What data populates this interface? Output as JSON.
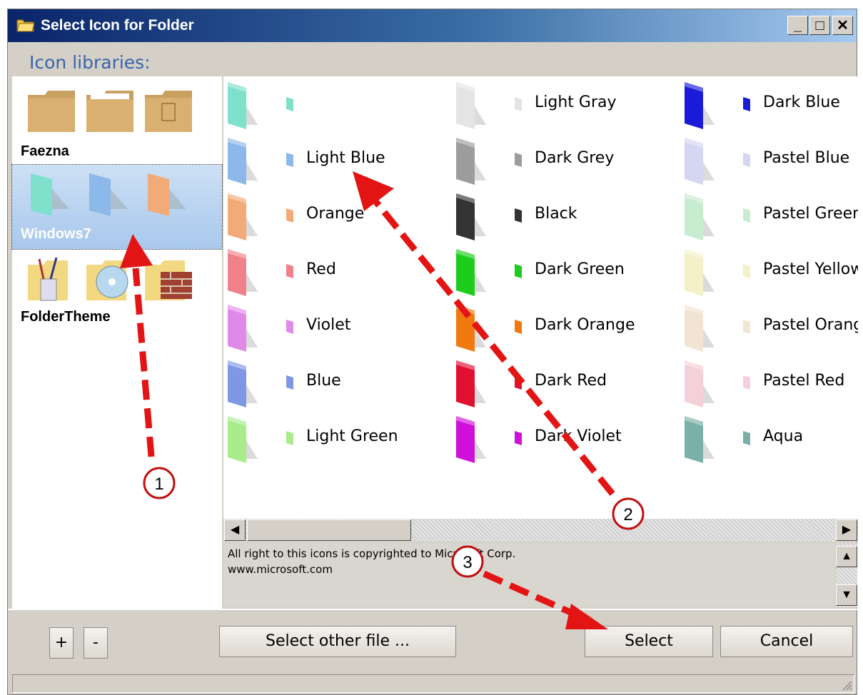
{
  "window": {
    "title": "Select Icon for Folder",
    "controls": {
      "minimize": "_",
      "maximize": "□",
      "close": "✕"
    }
  },
  "libraries_label": "Icon libraries:",
  "libraries": [
    {
      "name": "Faezna",
      "selected": false
    },
    {
      "name": "Windows7",
      "selected": true
    },
    {
      "name": "FolderTheme",
      "selected": false
    }
  ],
  "icons": [
    {
      "label": "",
      "color": "#7fe0cc"
    },
    {
      "label": "Light Gray",
      "color": "#e4e4e4"
    },
    {
      "label": "Dark Blue",
      "color": "#1a1ad8"
    },
    {
      "label": "Light Blue",
      "color": "#8cb8ea"
    },
    {
      "label": "Dark Grey",
      "color": "#9c9c9c"
    },
    {
      "label": "Pastel Blue",
      "color": "#d4d6f2"
    },
    {
      "label": "Orange",
      "color": "#f2aa78"
    },
    {
      "label": "Black",
      "color": "#333333"
    },
    {
      "label": "Pastel Green",
      "color": "#c8ecd0"
    },
    {
      "label": "Red",
      "color": "#f0808a"
    },
    {
      "label": "Dark Green",
      "color": "#1ecc1e"
    },
    {
      "label": "Pastel Yellow",
      "color": "#f4f0c8"
    },
    {
      "label": "Violet",
      "color": "#e08ae8"
    },
    {
      "label": "Dark Orange",
      "color": "#f07a10"
    },
    {
      "label": "Pastel Orange",
      "color": "#f2e4d2"
    },
    {
      "label": "Blue",
      "color": "#7e98e6"
    },
    {
      "label": "Dark Red",
      "color": "#e01030"
    },
    {
      "label": "Pastel Red",
      "color": "#f4d0d8"
    },
    {
      "label": "Light Green",
      "color": "#a8ec8c"
    },
    {
      "label": "Dark Violet",
      "color": "#d010d8"
    },
    {
      "label": "Aqua",
      "color": "#7ab0a8"
    }
  ],
  "copyright": {
    "line1": "All right to this icons is copyrighted to Microsoft Corp.",
    "line2": "www.microsoft.com"
  },
  "buttons": {
    "add": "+",
    "remove": "-",
    "select_other": "Select other file ...",
    "select": "Select",
    "cancel": "Cancel"
  },
  "annotations": {
    "step1": "1",
    "step2": "2",
    "step3": "3"
  },
  "colors": {
    "arrow": "#e31414",
    "titlebar_start": "#0a246a",
    "titlebar_end": "#a6caf0"
  }
}
